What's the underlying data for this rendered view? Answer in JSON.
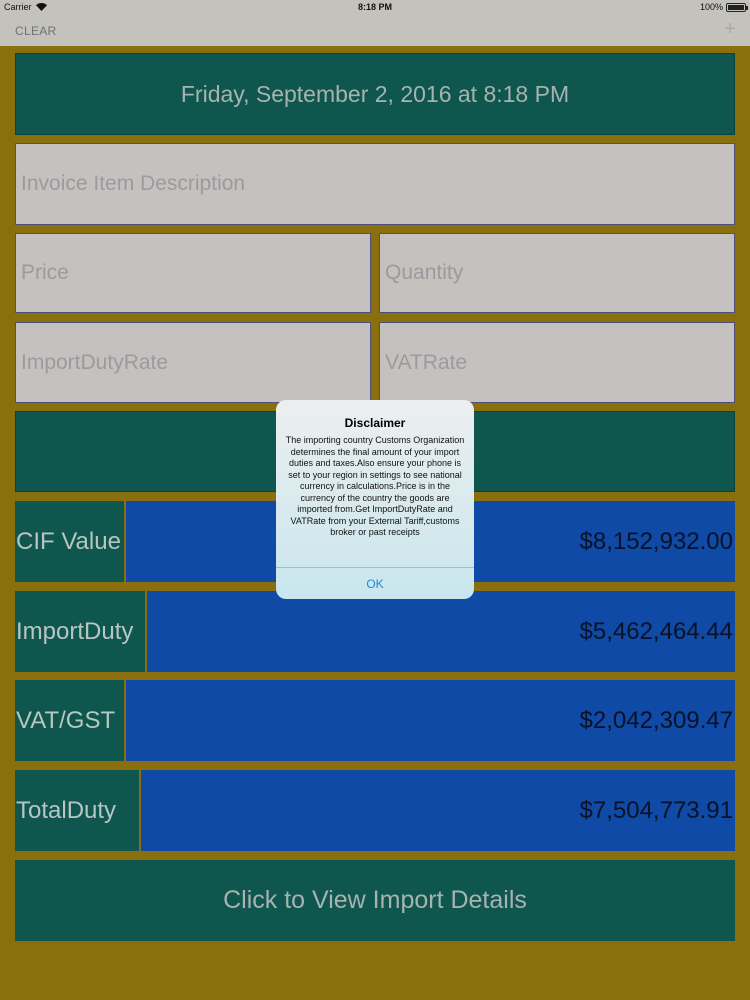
{
  "status_bar": {
    "carrier": "Carrier",
    "time": "8:18 PM",
    "battery": "100%",
    "battery_level": 1.0
  },
  "nav": {
    "clear_label": "CLEAR",
    "add_icon": "+"
  },
  "date_display": "Friday, September 2, 2016 at 8:18 PM",
  "inputs": {
    "description_placeholder": "Invoice Item Description",
    "price_placeholder": "Price",
    "quantity_placeholder": "Quantity",
    "duty_rate_placeholder": "ImportDutyRate",
    "vat_rate_placeholder": "VATRate"
  },
  "results": [
    {
      "label": "CIF Value",
      "value": "$8,152,932.00"
    },
    {
      "label": "ImportDuty",
      "value": "$5,462,464.44"
    },
    {
      "label": "VAT/GST",
      "value": "$2,042,309.47"
    },
    {
      "label": "TotalDuty",
      "value": "$7,504,773.91"
    }
  ],
  "view_details_label": "Click to View Import Details",
  "alert": {
    "title": "Disclaimer",
    "message": "The importing country Customs Organization determines the final amount of your import duties and taxes.Also ensure your phone is set to your region in settings to see national currency in calculations.Price is in the currency of the country the goods are imported from.Get ImportDutyRate and VATRate from your External Tariff,customs broker or past receipts",
    "ok_label": "OK"
  },
  "colors": {
    "background": "#8a6f0e",
    "teal": "#0f564f",
    "blue": "#0e4aa6",
    "link": "#1d8ad6"
  }
}
